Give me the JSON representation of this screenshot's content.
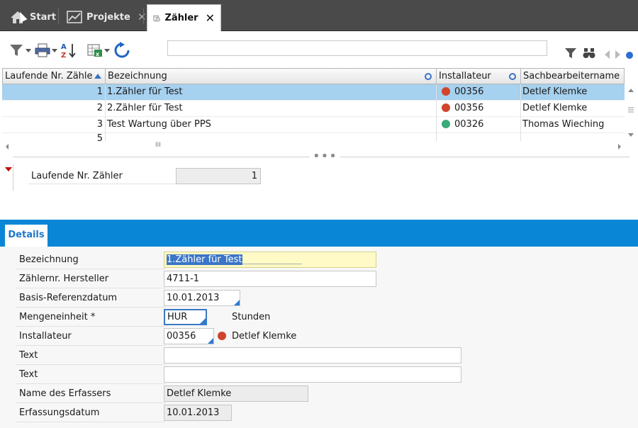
{
  "tabs": [
    {
      "label": "Start",
      "icon": "home-icon"
    },
    {
      "label": "Projekte",
      "icon": "chart-icon",
      "close": "✕"
    },
    {
      "label": "Zähler",
      "icon": "meter-calendar-icon",
      "close": "✕",
      "active": true
    }
  ],
  "toolbar": {
    "icons": [
      "filter-dropdown-icon",
      "print-dropdown-icon",
      "sort-az-icon",
      "excel-export-icon",
      "refresh-icon"
    ],
    "right_icons": [
      "filter-icon",
      "binoculars-icon",
      "nav-prev-icon",
      "nav-next-icon",
      "status-dot-icon"
    ],
    "search_value": ""
  },
  "grid": {
    "columns": [
      "Laufende Nr. Zähle",
      "Bezeichnung",
      "Installateur",
      "Sachbearbeitername"
    ],
    "rows": [
      {
        "nr": "1",
        "bezeichnung": "1.Zähler für Test",
        "installateur": "00356",
        "status": "red",
        "sachbearbeiter": "Detlef Klemke"
      },
      {
        "nr": "2",
        "bezeichnung": "2.Zähler für Test",
        "installateur": "00356",
        "status": "red",
        "sachbearbeiter": "Detlef Klemke"
      },
      {
        "nr": "3",
        "bezeichnung": "Test Wartung über PPS",
        "installateur": "00326",
        "status": "green",
        "sachbearbeiter": "Thomas Wieching"
      },
      {
        "nr": "5",
        "bezeichnung": "",
        "installateur": "",
        "status": "",
        "sachbearbeiter": ""
      }
    ],
    "scroll_mid": "III"
  },
  "record": {
    "label": "Laufende Nr. Zähler",
    "value": "1"
  },
  "details": {
    "tab_label": "Details",
    "fields": {
      "bezeichnung": {
        "label": "Bezeichnung",
        "value": "1.Zähler für Test",
        "trailing": "_____________"
      },
      "zaehlernr": {
        "label": "Zählernr. Hersteller",
        "value": "4711-1"
      },
      "basisdatum": {
        "label": "Basis-Referenzdatum",
        "value": "10.01.2013"
      },
      "mengeneinheit": {
        "label": "Mengeneinheit *",
        "value": "HUR",
        "description": "Stunden"
      },
      "installateur": {
        "label": "Installateur",
        "value": "00356",
        "name": "Detlef Klemke"
      },
      "text1": {
        "label": "Text",
        "value": ""
      },
      "text2": {
        "label": "Text",
        "value": ""
      },
      "erfasser": {
        "label": "Name des Erfassers",
        "value": "Detlef Klemke"
      },
      "erfassungsdatum": {
        "label": "Erfassungsdatum",
        "value": "10.01.2013"
      }
    }
  },
  "colors": {
    "accent": "#0a86d6",
    "selection": "#a6d1ef",
    "status_red": "#d0452c",
    "status_green": "#3aaa7a",
    "highlight": "#fffac6"
  }
}
